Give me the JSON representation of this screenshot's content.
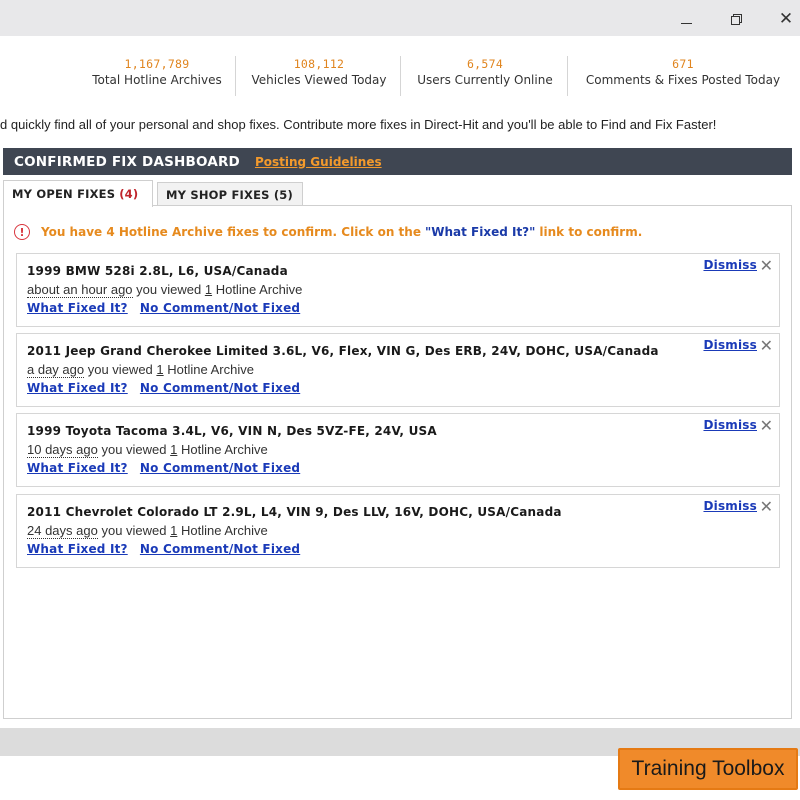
{
  "window": {
    "minimize": "—",
    "close": "✕"
  },
  "stats": [
    {
      "value": "1,167,789",
      "label": "Total Hotline Archives"
    },
    {
      "value": "108,112",
      "label": "Vehicles Viewed Today"
    },
    {
      "value": "6,574",
      "label": "Users Currently Online"
    },
    {
      "value": "671",
      "label": "Comments & Fixes Posted Today"
    }
  ],
  "intro_text": "d quickly find all of your personal and shop fixes. Contribute more fixes in Direct-Hit and you'll be able to Find and Fix Faster!",
  "dashboard": {
    "title": "CONFIRMED FIX DASHBOARD",
    "guidelines_link": "Posting Guidelines"
  },
  "tabs": [
    {
      "label": "MY OPEN FIXES",
      "count": "(4)"
    },
    {
      "label": "MY SHOP FIXES (5)"
    }
  ],
  "notice": {
    "icon": "!",
    "before": "You have 4 Hotline Archive fixes to confirm. Click on the",
    "quote": "\"What Fixed It?\"",
    "after": "link to confirm."
  },
  "fixes": [
    {
      "vehicle": "1999 BMW 528i 2.8L, L6, USA/Canada",
      "ago": "about an hour ago",
      "viewed_text": "you viewed",
      "n": "1",
      "archive_text": "Hotline Archive"
    },
    {
      "vehicle": "2011 Jeep Grand Cherokee Limited 3.6L, V6, Flex, VIN G, Des ERB, 24V, DOHC, USA/Canada",
      "ago": "a day ago",
      "viewed_text": "you viewed",
      "n": "1",
      "archive_text": "Hotline Archive"
    },
    {
      "vehicle": "1999 Toyota Tacoma 3.4L, V6, VIN N, Des 5VZ-FE, 24V, USA",
      "ago": "10 days ago",
      "viewed_text": "you viewed",
      "n": "1",
      "archive_text": "Hotline Archive"
    },
    {
      "vehicle": "2011 Chevrolet Colorado LT 2.9L, L4, VIN 9, Des LLV, 16V, DOHC, USA/Canada",
      "ago": "24 days ago",
      "viewed_text": "you viewed",
      "n": "1",
      "archive_text": "Hotline Archive"
    }
  ],
  "fix_actions": {
    "what_fixed": "What Fixed It?",
    "no_comment": "No Comment/Not Fixed",
    "dismiss": "Dismiss",
    "dismiss_x": "✕"
  },
  "training_toolbox": "Training Toolbox",
  "colors": {
    "accent_orange": "#e0851f",
    "header_bg": "#3f4652",
    "link_blue": "#1a3ab8",
    "alert_red": "#d9363e",
    "button_orange": "#f08a2a"
  }
}
